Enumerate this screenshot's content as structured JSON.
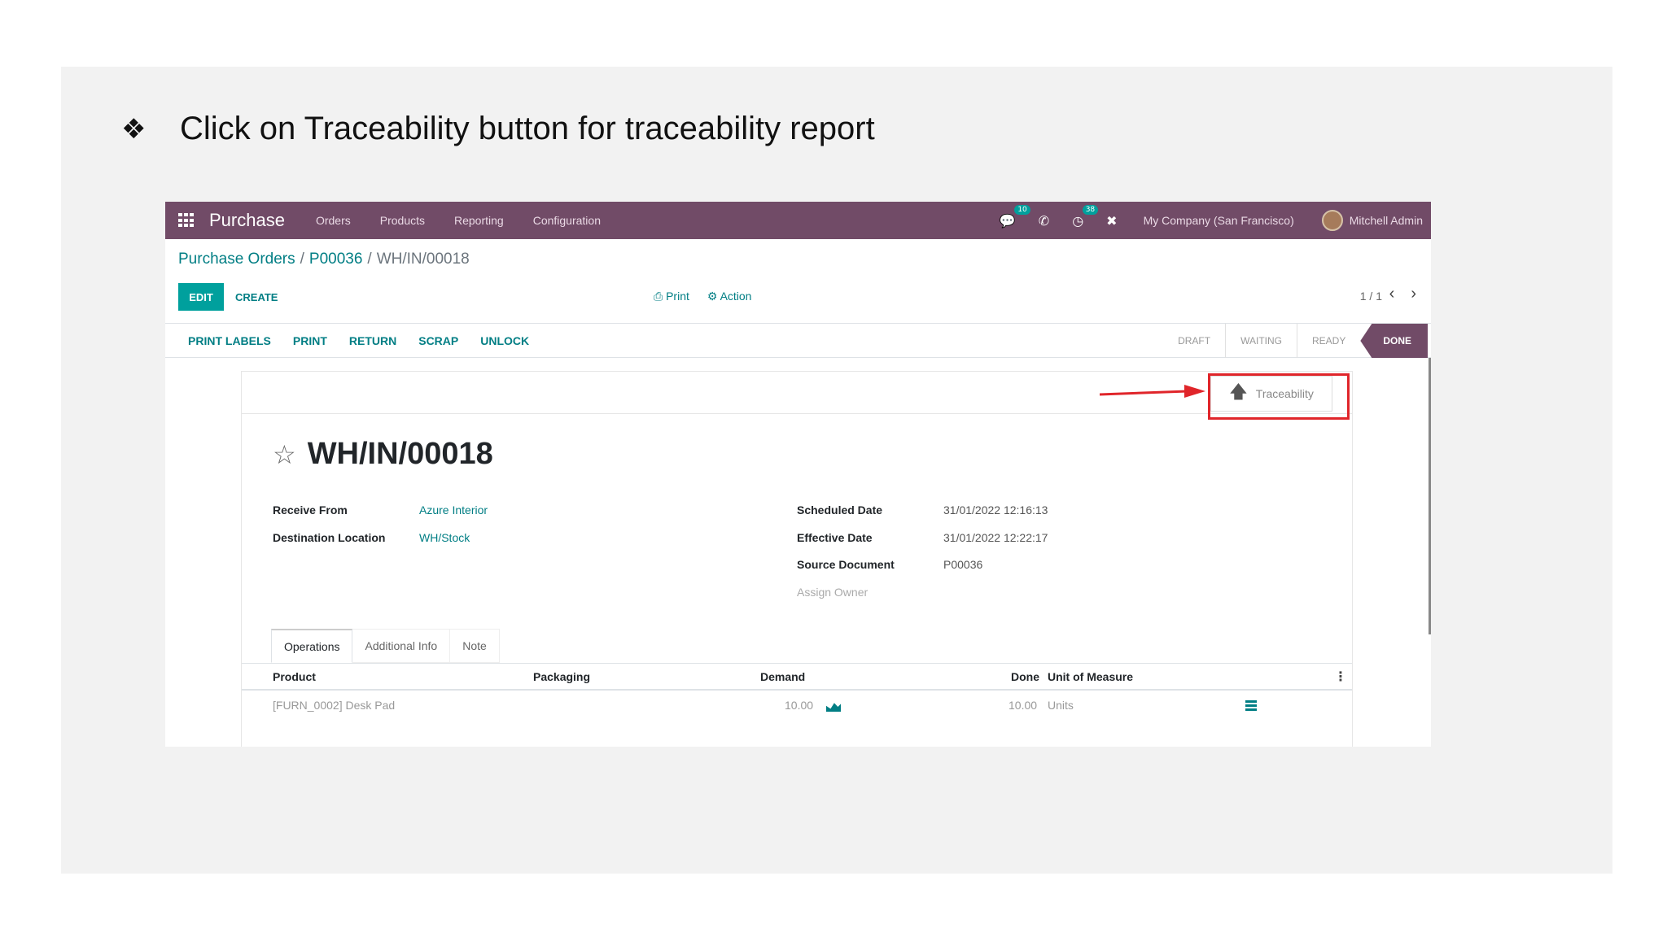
{
  "slide": {
    "bullet_glyph": "❖",
    "instruction": "Click on Traceability button for traceability report"
  },
  "navbar": {
    "app_title": "Purchase",
    "menus": [
      "Orders",
      "Products",
      "Reporting",
      "Configuration"
    ],
    "messages_badge": "10",
    "activity_badge": "38",
    "company": "My Company (San Francisco)",
    "user": "Mitchell Admin",
    "icons": [
      "apps-grid-icon",
      "chat-icon",
      "phone-icon",
      "clock-icon",
      "close-icon"
    ],
    "bg_color": "#714b67"
  },
  "breadcrumb": {
    "items": [
      "Purchase Orders",
      "P00036"
    ],
    "separator": "/",
    "current": "WH/IN/00018"
  },
  "control": {
    "edit_label": "EDIT",
    "create_label": "CREATE",
    "print_label": "Print",
    "action_label": "Action",
    "pager": "1 / 1"
  },
  "statusbar": {
    "buttons": [
      "PRINT LABELS",
      "PRINT",
      "RETURN",
      "SCRAP",
      "UNLOCK"
    ],
    "stages": [
      "DRAFT",
      "WAITING",
      "READY",
      "DONE"
    ],
    "active_stage": "DONE"
  },
  "sheet": {
    "traceability_label": "Traceability",
    "title": "WH/IN/00018",
    "left_fields": [
      {
        "label": "Receive From",
        "value": "Azure Interior"
      },
      {
        "label": "Destination Location",
        "value": "WH/Stock"
      }
    ],
    "right_fields": [
      {
        "label": "Scheduled Date",
        "value": "31/01/2022 12:16:13"
      },
      {
        "label": "Effective Date",
        "value": "31/01/2022 12:22:17"
      },
      {
        "label": "Source Document",
        "value": "P00036"
      }
    ],
    "assign_owner_label": "Assign Owner",
    "tabs": [
      "Operations",
      "Additional Info",
      "Note"
    ],
    "table": {
      "headers": [
        "Product",
        "Packaging",
        "Demand",
        "Done",
        "Unit of Measure"
      ],
      "rows": [
        {
          "product": "[FURN_0002] Desk Pad",
          "demand": "10.00",
          "done": "10.00",
          "uom": "Units"
        }
      ]
    },
    "highlight_color": "#e0252a"
  }
}
